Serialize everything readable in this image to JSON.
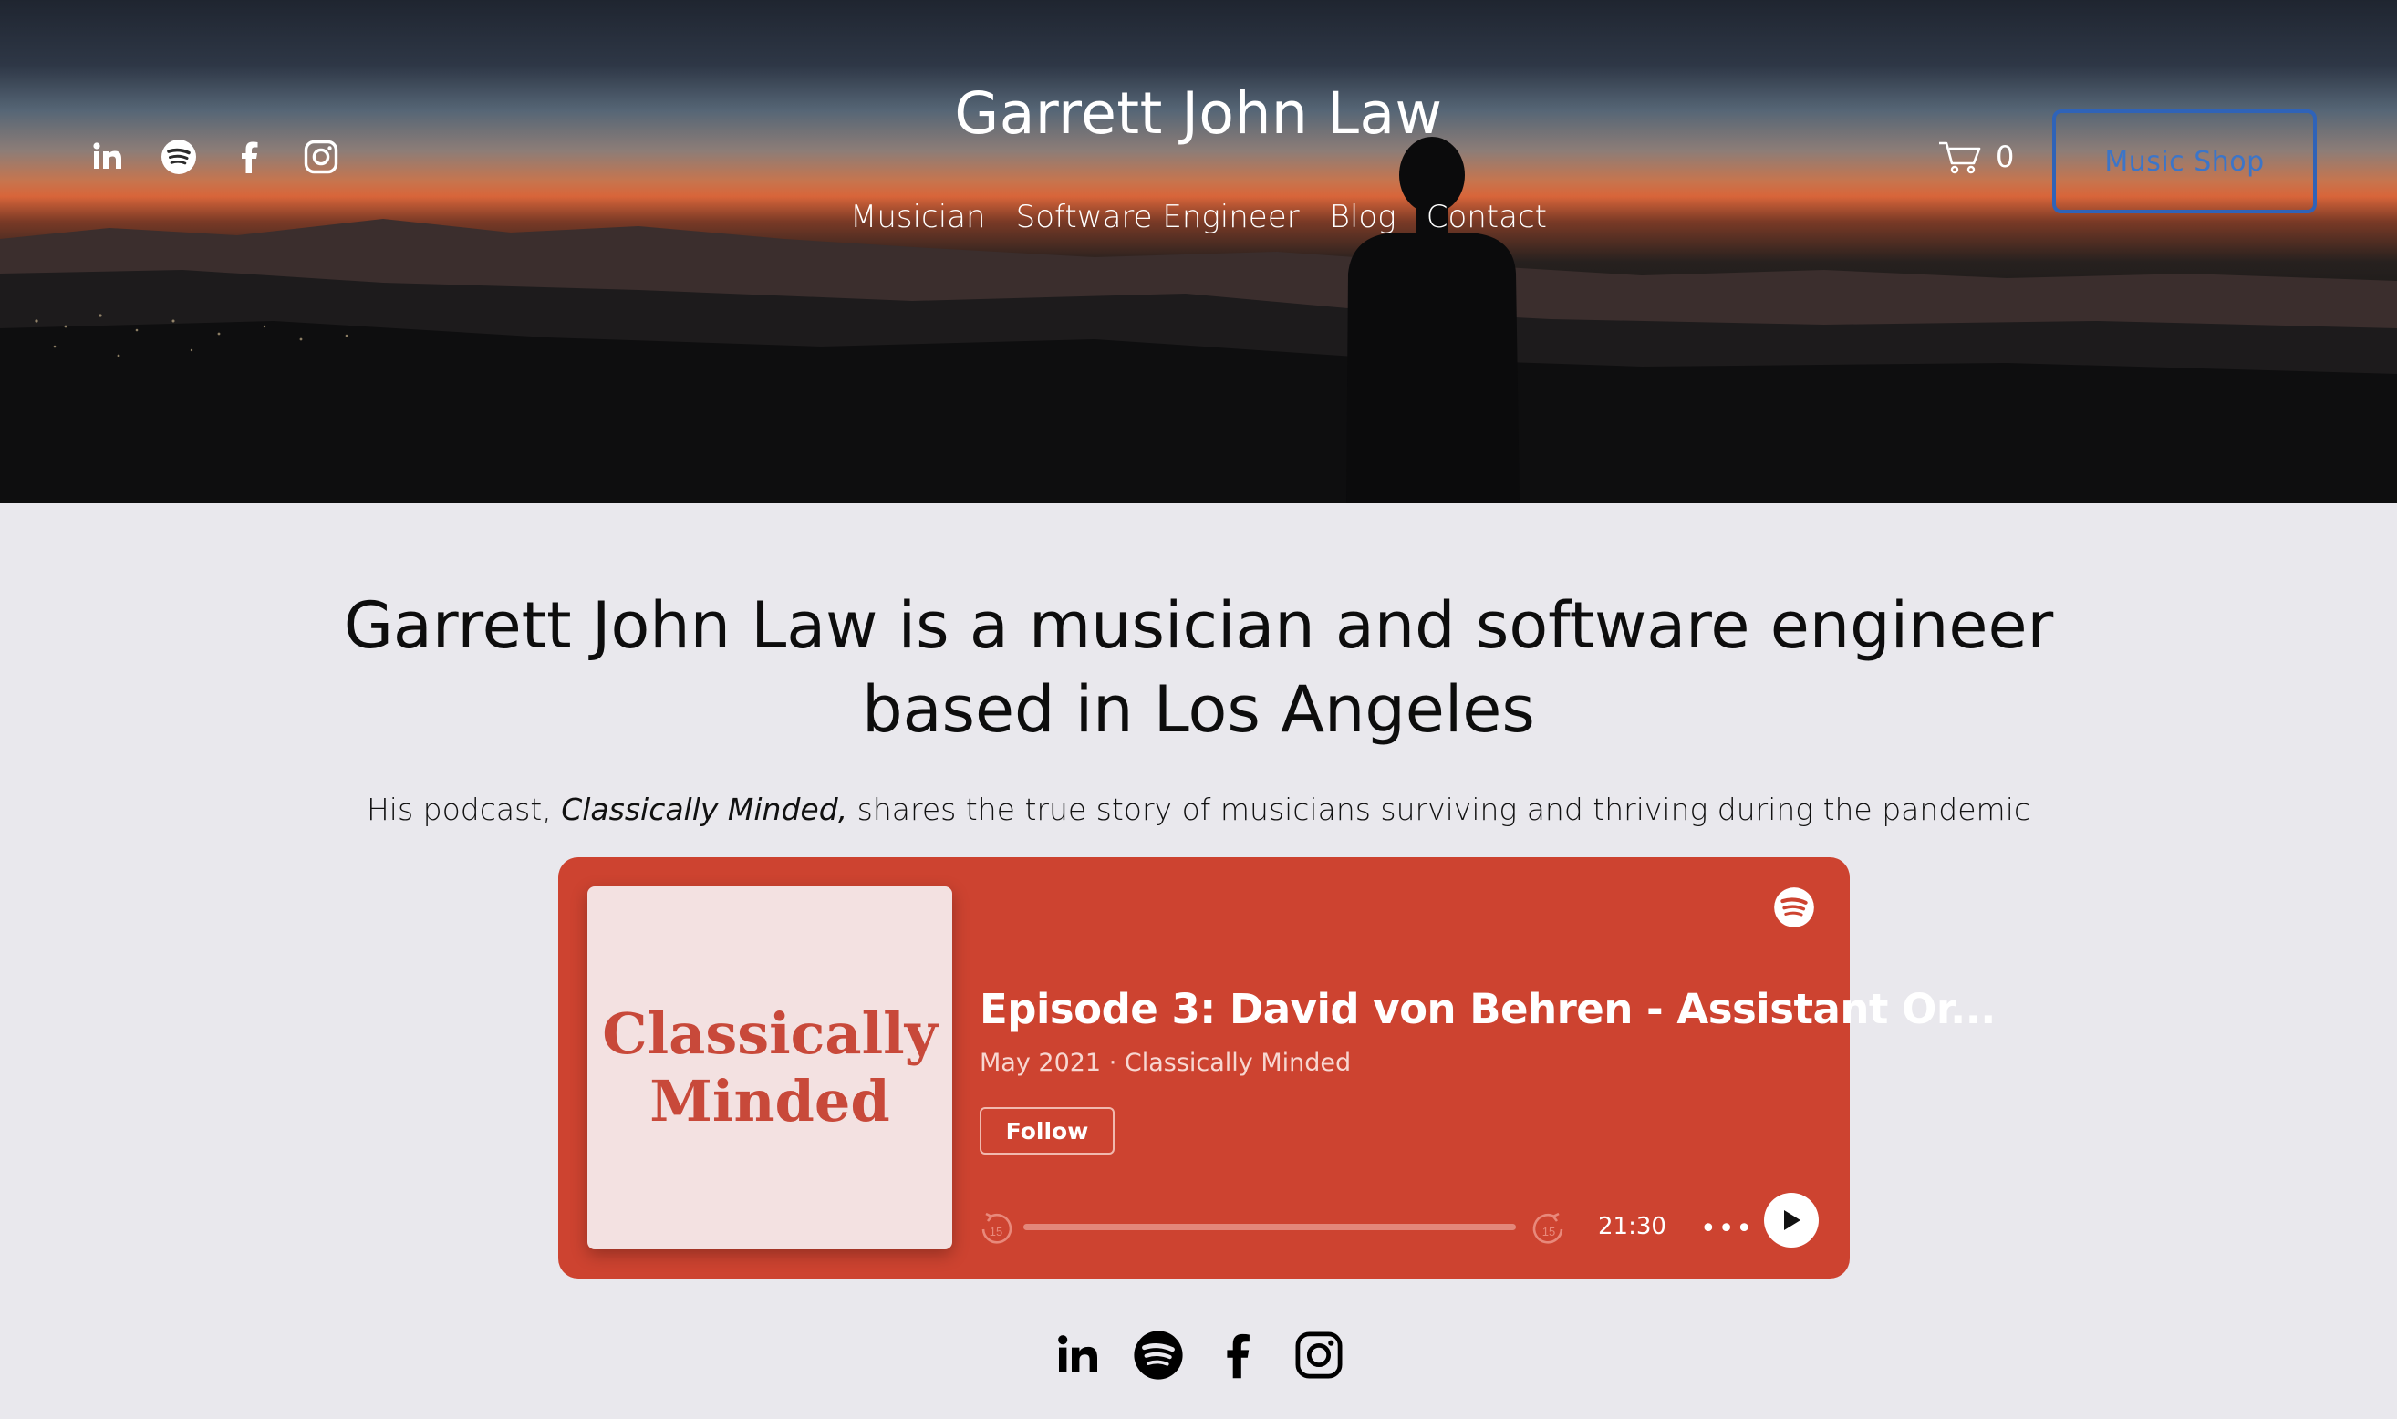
{
  "header": {
    "site_title": "Garrett John Law",
    "nav": [
      "Musician",
      "Software Engineer",
      "Blog",
      "Contact"
    ],
    "social_icons": [
      "linkedin-icon",
      "spotify-icon",
      "facebook-icon",
      "instagram-icon"
    ],
    "cart_count": "0",
    "shop_button": "Music Shop"
  },
  "main": {
    "headline": "Garrett John Law is a musician and software engineer based in Los Angeles",
    "intro_prefix": "His podcast, ",
    "intro_title": "Classically Minded,",
    "intro_suffix": " shares the true story of musicians surviving and thriving during the pandemic"
  },
  "podcast": {
    "cover_line1": "Classically",
    "cover_line2": "Minded",
    "episode_title": "Episode 3: David von Behren - Assistant Or...",
    "meta": "May 2021 · Classically Minded",
    "follow_label": "Follow",
    "duration": "21:30",
    "more_label": "•••",
    "progress": 0.0,
    "skip_seconds": "15"
  },
  "footer": {
    "social_icons": [
      "linkedin-icon",
      "spotify-icon",
      "facebook-icon",
      "instagram-icon"
    ]
  },
  "colors": {
    "page_bg": "#e9e8ed",
    "widget_bg": "#cd4330",
    "cover_bg": "#f3e1e1",
    "cover_text": "#c8493a",
    "shop_button_border": "#2f63b8"
  }
}
